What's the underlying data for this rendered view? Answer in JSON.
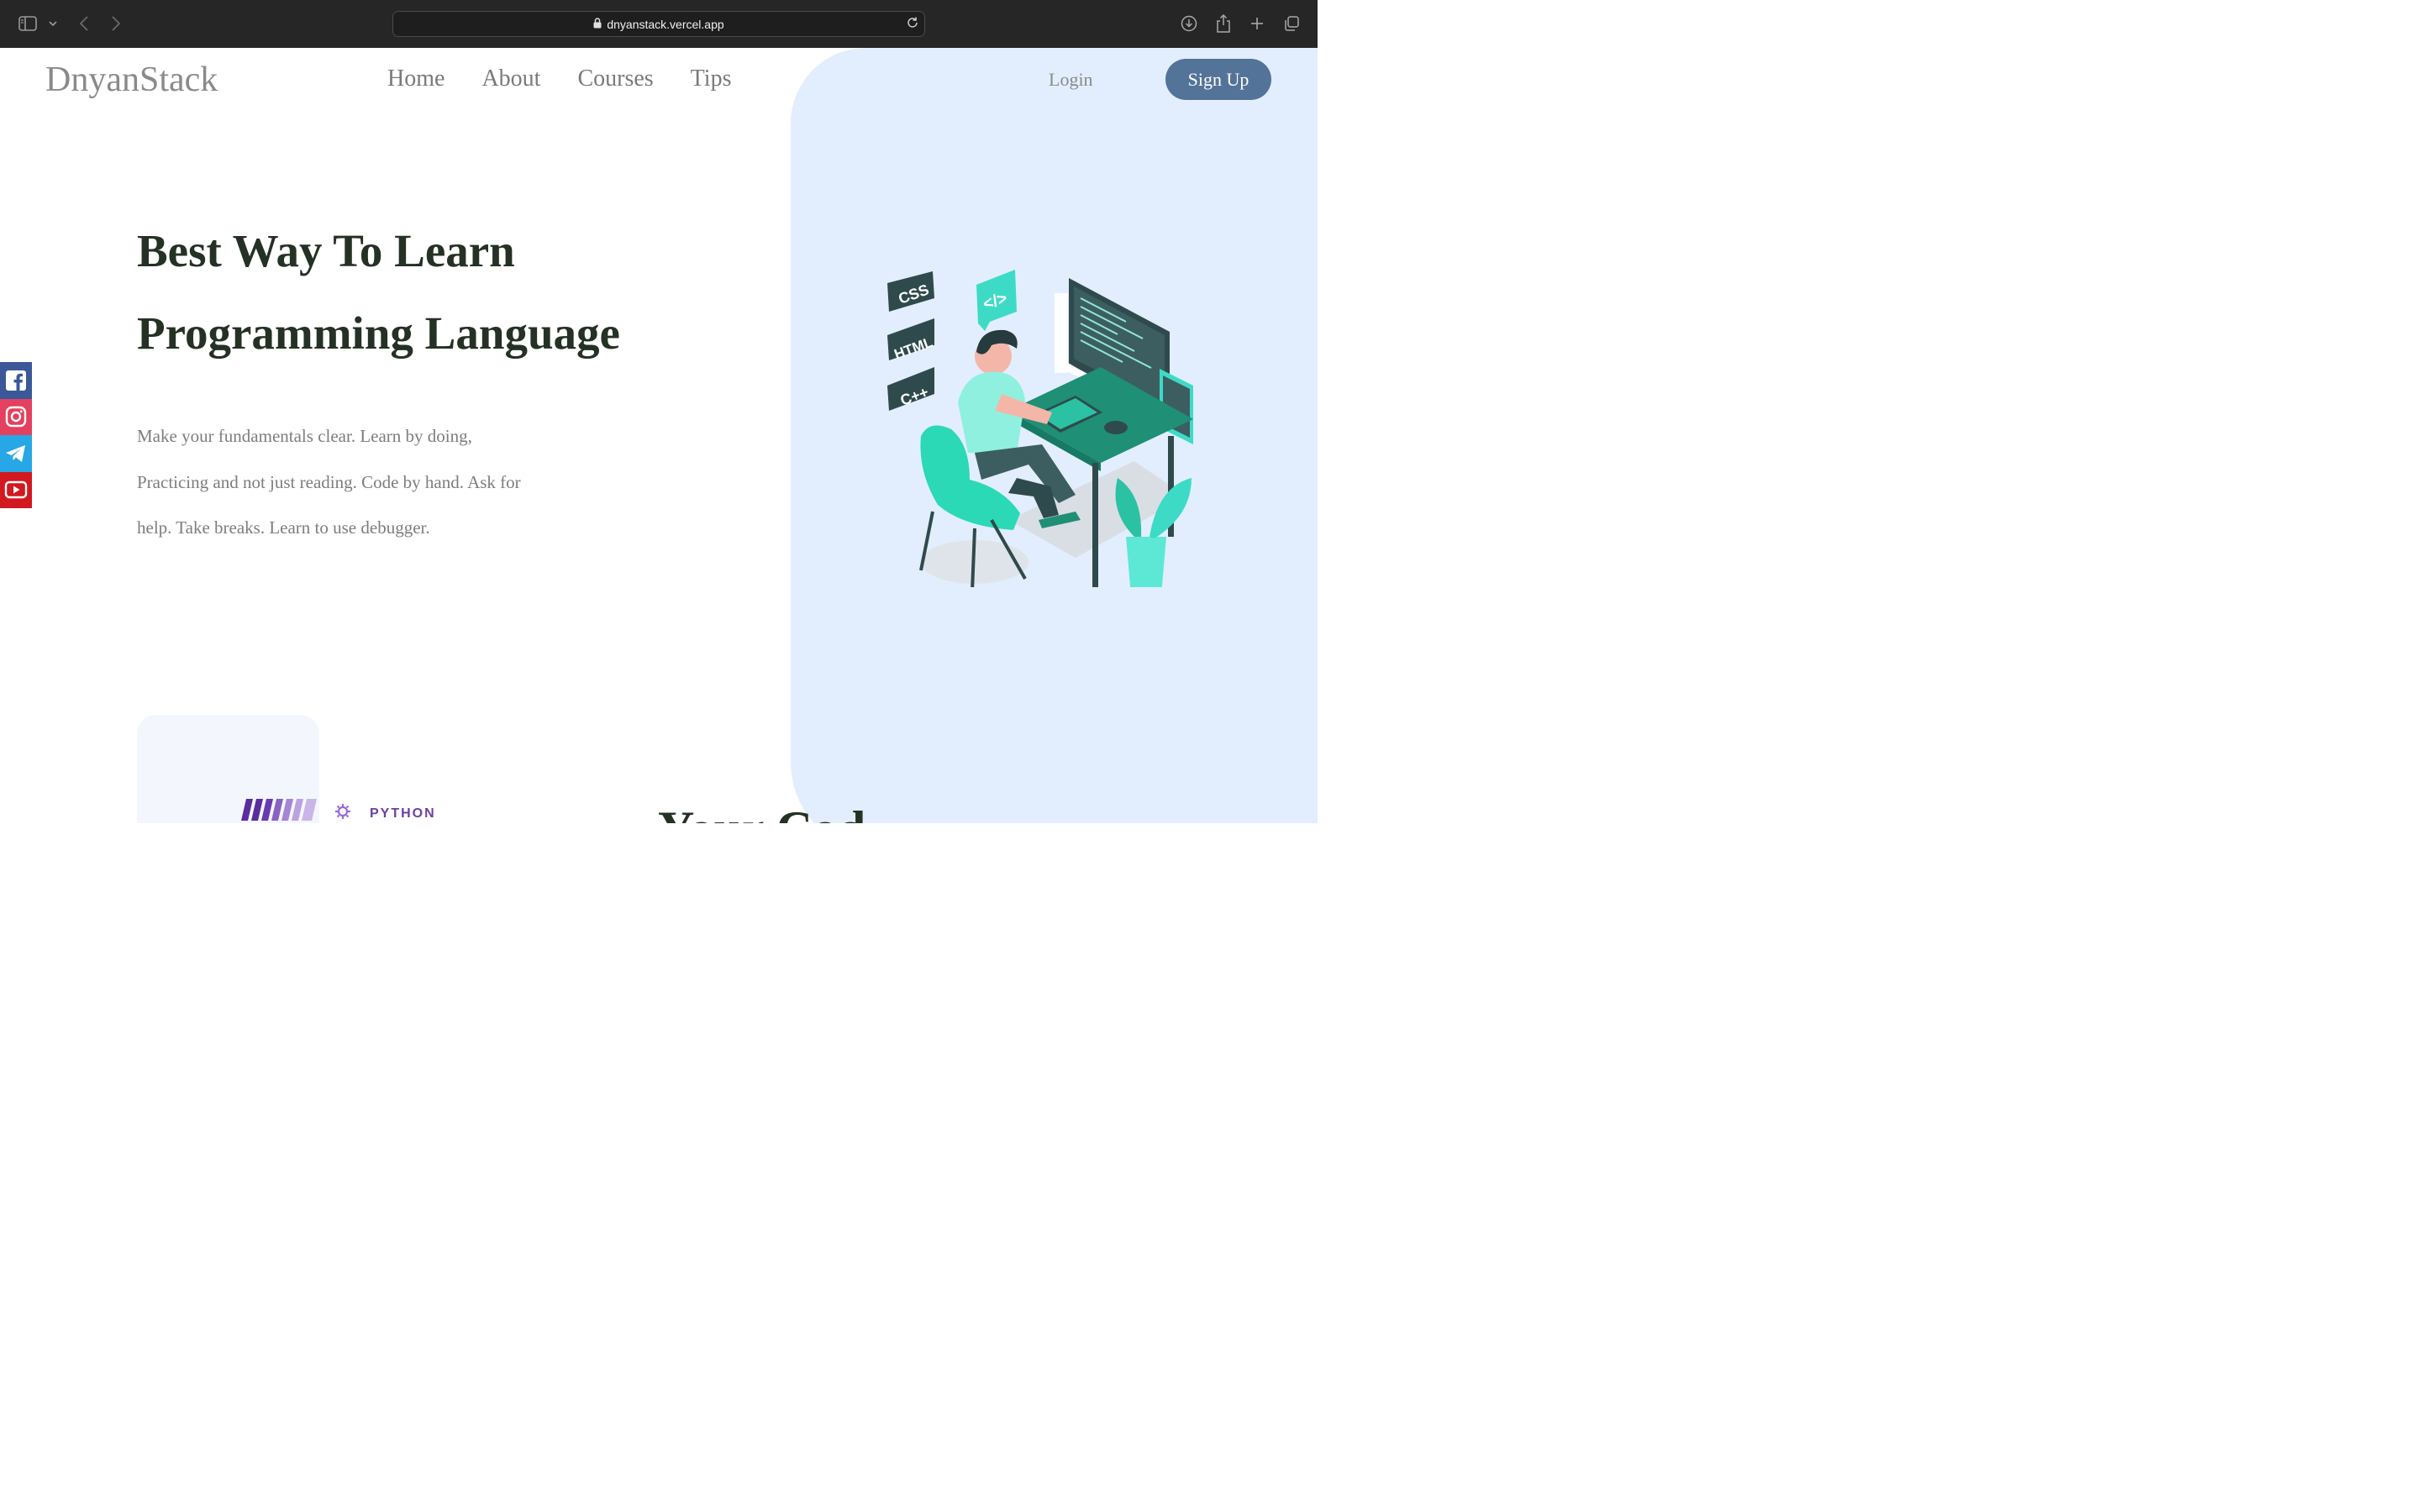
{
  "browser": {
    "url": "dnyanstack.vercel.app",
    "icons": [
      "sidebar-icon",
      "chevron-down-icon",
      "back-icon",
      "forward-icon",
      "lock-icon",
      "reload-icon",
      "download-icon",
      "share-icon",
      "new-tab-icon",
      "tabs-overview-icon"
    ]
  },
  "header": {
    "logo": "DnyanStack",
    "nav": [
      "Home",
      "About",
      "Courses",
      "Tips"
    ],
    "login": "Login",
    "signup": "Sign Up"
  },
  "hero": {
    "title_line1": "Best Way To Learn",
    "title_line2": "Programming Language",
    "desc_line1": "Make your fundamentals clear. Learn by doing,",
    "desc_line2": "Practicing and not just reading. Code by hand. Ask for",
    "desc_line3": "help. Take breaks. Learn to use debugger."
  },
  "illustration": {
    "tags": [
      "CSS",
      "HTML",
      "C++"
    ],
    "code_badge": "</>"
  },
  "social": {
    "items": [
      "facebook",
      "instagram",
      "telegram",
      "youtube"
    ],
    "colors": [
      "#3b5998",
      "#e4405f",
      "#27a7e5",
      "#d1191f"
    ]
  },
  "section2": {
    "badge_text": "PYTHON",
    "heading_partial": "Your Cod"
  },
  "colors": {
    "accent_blue": "#547399",
    "hero_bg": "#e2eefd",
    "heading": "#243124",
    "teal": "#2bc2a3"
  }
}
